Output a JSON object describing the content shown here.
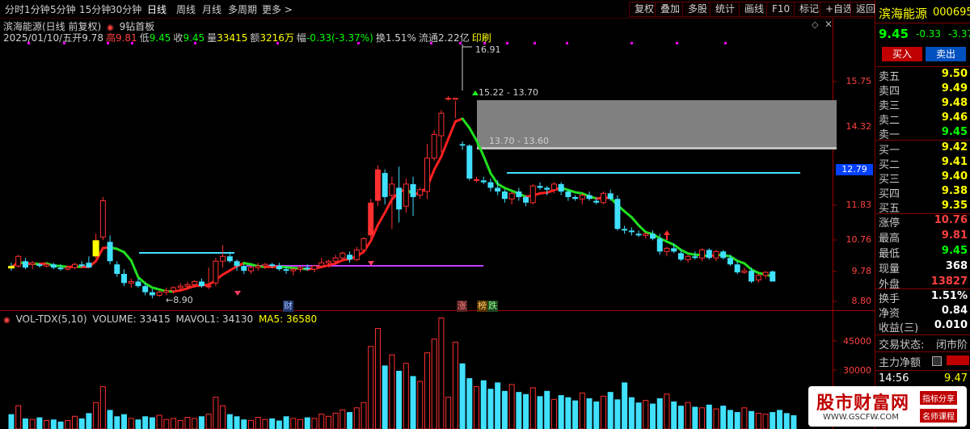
{
  "tabs": [
    "分时",
    "1分钟",
    "5分钟",
    "15分钟",
    "30分钟",
    "日线",
    "周线",
    "月线",
    "多周期",
    "更多 >"
  ],
  "active_tab": "日线",
  "right_tabs": [
    "复权",
    "叠加",
    "多股",
    "统计",
    "画线",
    "F10",
    "标记",
    "+自选",
    "返回"
  ],
  "info": {
    "name": "滨海能源(日线 前复权)",
    "indicator": "9钻首板",
    "date": "2025/01/10/五",
    "open_label": "开",
    "open": "9.78",
    "high_label": "高",
    "high": "9.81",
    "low_label": "低",
    "low": "9.45",
    "close_label": "收",
    "close": "9.45",
    "vol_label": "量",
    "vol": "33415",
    "amt_label": "额",
    "amt": "3216万",
    "amp_label": "幅",
    "amp": "-0.33(-3.37%)",
    "turn_label": "换",
    "turn": "1.51%",
    "float_label": "流通",
    "float": "2.22亿",
    "print": "印刷"
  },
  "price_axis": [
    "15.75",
    "14.32",
    "12.79",
    "11.83",
    "10.76",
    "9.78",
    "8.80"
  ],
  "current_price_tag": "12.79",
  "annotations": {
    "high_label": "16.91",
    "zone_top_label": "15.22 - 13.70",
    "zone_bottom_label": "13.70 - 13.60",
    "low_label": "8.90",
    "cai": "财",
    "zhang": "涨",
    "die": "跌",
    "bang": "榜"
  },
  "volume_indicator": {
    "name": "VOL-TDX(5,10)",
    "volume": "VOLUME: 33415",
    "mavol1": "MAVOL1: 34130",
    "ma5": "MA5: 36580",
    "axis": [
      "45000",
      "30000"
    ]
  },
  "panel": {
    "stock_name": "滨海能源",
    "code": "000695",
    "price": "9.45",
    "change": "-0.33",
    "change_pct": "-3.37",
    "buy_button": "买入",
    "sell_button": "卖出",
    "asks": [
      {
        "label": "卖五",
        "value": "9.50"
      },
      {
        "label": "卖四",
        "value": "9.49"
      },
      {
        "label": "卖三",
        "value": "9.48"
      },
      {
        "label": "卖二",
        "value": "9.46"
      },
      {
        "label": "卖一",
        "value": "9.45"
      }
    ],
    "bids": [
      {
        "label": "买一",
        "value": "9.42"
      },
      {
        "label": "买二",
        "value": "9.41"
      },
      {
        "label": "买三",
        "value": "9.40"
      },
      {
        "label": "买四",
        "value": "9.38"
      },
      {
        "label": "买五",
        "value": "9.35"
      }
    ],
    "stats": [
      {
        "label": "涨停",
        "value": "10.76",
        "color": "#ff4040"
      },
      {
        "label": "最高",
        "value": "9.81",
        "color": "#ff4040"
      },
      {
        "label": "最低",
        "value": "9.45",
        "color": "#00ff00"
      },
      {
        "label": "现量",
        "value": "368",
        "color": "#ffffff"
      },
      {
        "label": "外盘",
        "value": "13827",
        "color": "#ff4040"
      }
    ],
    "stats2": [
      {
        "label": "换手",
        "value": "1.51%",
        "color": "#ffffff"
      },
      {
        "label": "净资",
        "value": "0.84",
        "color": "#ffffff"
      },
      {
        "label": "收益(三)",
        "value": "0.010",
        "color": "#ffffff"
      }
    ],
    "trade_status_label": "交易状态:",
    "trade_status": "闭市阶",
    "net_flow_label": "主力净额",
    "time": "14:56",
    "time_price": "9.47"
  },
  "watermark": {
    "text": "股市财富网",
    "url": "WWW.GSCFW.COM",
    "tag1": "指标分享",
    "tag2": "名师课程"
  },
  "chart_data": {
    "type": "candlestick",
    "candles": [
      [
        9.95,
        10.05,
        9.8,
        9.9
      ],
      [
        9.95,
        10.3,
        9.9,
        10.25
      ],
      [
        10.1,
        10.2,
        9.85,
        9.9
      ],
      [
        10.0,
        10.1,
        9.85,
        10.05
      ],
      [
        10.0,
        10.05,
        9.9,
        9.95
      ],
      [
        9.95,
        10.05,
        9.9,
        10.0
      ],
      [
        10.0,
        10.05,
        9.85,
        9.9
      ],
      [
        9.9,
        10.0,
        9.8,
        9.85
      ],
      [
        9.85,
        9.95,
        9.8,
        9.9
      ],
      [
        9.9,
        10.05,
        9.85,
        10.0
      ],
      [
        10.0,
        10.1,
        9.9,
        9.95
      ],
      [
        10.05,
        10.25,
        9.9,
        9.9
      ],
      [
        10.25,
        10.95,
        10.2,
        10.75
      ],
      [
        10.85,
        12.05,
        10.75,
        11.95
      ],
      [
        10.7,
        10.9,
        10.0,
        10.1
      ],
      [
        10.0,
        10.1,
        9.6,
        9.7
      ],
      [
        9.7,
        9.85,
        9.3,
        9.4
      ],
      [
        9.4,
        9.55,
        9.25,
        9.45
      ],
      [
        9.45,
        9.55,
        9.25,
        9.3
      ],
      [
        9.3,
        9.4,
        9.0,
        9.1
      ],
      [
        9.1,
        9.2,
        8.9,
        9.0
      ],
      [
        9.0,
        9.15,
        8.95,
        9.1
      ],
      [
        9.1,
        9.25,
        9.0,
        9.15
      ],
      [
        9.15,
        9.3,
        9.05,
        9.25
      ],
      [
        9.25,
        9.4,
        9.15,
        9.3
      ],
      [
        9.3,
        9.45,
        9.2,
        9.35
      ],
      [
        9.35,
        9.5,
        9.25,
        9.45
      ],
      [
        9.45,
        9.55,
        9.25,
        9.3
      ],
      [
        9.3,
        9.9,
        9.2,
        9.3
      ],
      [
        9.4,
        10.2,
        9.3,
        10.1
      ],
      [
        10.1,
        10.6,
        9.9,
        10.25
      ],
      [
        10.25,
        10.4,
        10.05,
        10.1
      ],
      [
        10.1,
        10.15,
        9.8,
        9.95
      ],
      [
        9.95,
        10.0,
        9.7,
        9.8
      ],
      [
        9.8,
        9.95,
        9.7,
        9.9
      ],
      [
        9.9,
        10.05,
        9.8,
        9.95
      ],
      [
        9.95,
        10.05,
        9.85,
        10.0
      ],
      [
        10.0,
        10.05,
        9.9,
        9.95
      ],
      [
        9.95,
        10.05,
        9.8,
        9.85
      ],
      [
        9.85,
        9.95,
        9.7,
        9.8
      ],
      [
        9.8,
        9.9,
        9.65,
        9.85
      ],
      [
        9.85,
        9.95,
        9.75,
        9.9
      ],
      [
        9.9,
        10.0,
        9.8,
        9.85
      ],
      [
        9.85,
        9.95,
        9.75,
        9.95
      ],
      [
        9.95,
        10.2,
        9.9,
        10.05
      ],
      [
        10.05,
        10.15,
        9.9,
        10.1
      ],
      [
        10.1,
        10.3,
        10.0,
        10.2
      ],
      [
        10.2,
        10.4,
        10.1,
        10.35
      ],
      [
        10.3,
        10.4,
        10.05,
        10.15
      ],
      [
        10.15,
        10.55,
        10.1,
        10.45
      ],
      [
        10.45,
        10.85,
        10.45,
        10.8
      ],
      [
        10.9,
        12.0,
        10.8,
        11.9
      ],
      [
        11.95,
        12.95,
        11.8,
        12.8
      ],
      [
        12.7,
        12.8,
        11.85,
        12.05
      ],
      [
        12.1,
        12.6,
        11.1,
        12.4
      ],
      [
        12.3,
        12.9,
        11.3,
        11.7
      ],
      [
        11.8,
        12.55,
        11.6,
        12.4
      ],
      [
        12.4,
        12.6,
        11.5,
        12.05
      ],
      [
        12.1,
        12.3,
        12.0,
        12.25
      ],
      [
        12.2,
        13.7,
        12.0,
        13.2
      ],
      [
        13.2,
        14.2,
        13.1,
        14.05
      ],
      [
        14.0,
        14.85,
        13.4,
        14.75
      ],
      [
        15.2,
        15.3,
        15.15,
        15.22
      ],
      [
        15.22,
        16.91,
        15.15,
        15.22
      ],
      [
        13.7,
        13.8,
        13.5,
        13.65
      ],
      [
        13.65,
        13.7,
        12.5,
        12.55
      ],
      [
        12.5,
        12.6,
        12.45,
        12.52
      ],
      [
        12.5,
        12.6,
        12.4,
        12.45
      ],
      [
        12.45,
        12.55,
        12.2,
        12.3
      ],
      [
        12.3,
        12.5,
        12.1,
        12.2
      ],
      [
        12.2,
        12.25,
        11.9,
        12.0
      ],
      [
        12.0,
        12.2,
        11.85,
        12.15
      ],
      [
        12.2,
        12.3,
        11.95,
        12.05
      ],
      [
        12.05,
        12.1,
        11.8,
        11.9
      ],
      [
        11.9,
        12.4,
        11.85,
        12.35
      ],
      [
        12.35,
        12.45,
        12.25,
        12.3
      ],
      [
        12.3,
        12.35,
        12.1,
        12.25
      ],
      [
        12.25,
        12.45,
        12.15,
        12.4
      ],
      [
        12.4,
        12.45,
        12.1,
        12.2
      ],
      [
        12.2,
        12.25,
        11.95,
        12.05
      ],
      [
        12.05,
        12.1,
        11.95,
        12.0
      ],
      [
        12.0,
        12.15,
        11.85,
        12.1
      ],
      [
        12.1,
        12.2,
        11.95,
        12.0
      ],
      [
        11.95,
        12.05,
        11.85,
        11.9
      ],
      [
        11.9,
        12.2,
        11.85,
        12.15
      ],
      [
        12.15,
        12.25,
        11.95,
        12.0
      ],
      [
        12.0,
        12.1,
        11.05,
        11.1
      ],
      [
        11.1,
        11.2,
        10.95,
        11.05
      ],
      [
        11.05,
        11.15,
        10.9,
        11.0
      ],
      [
        10.95,
        11.05,
        10.85,
        10.9
      ],
      [
        10.9,
        11.0,
        10.8,
        10.95
      ],
      [
        10.95,
        11.05,
        10.75,
        10.8
      ],
      [
        10.8,
        10.95,
        10.3,
        10.4
      ],
      [
        10.4,
        10.55,
        10.25,
        10.5
      ],
      [
        10.5,
        10.65,
        10.35,
        10.4
      ],
      [
        10.35,
        10.45,
        10.1,
        10.15
      ],
      [
        10.15,
        10.3,
        10.05,
        10.25
      ],
      [
        10.25,
        10.4,
        10.15,
        10.2
      ],
      [
        10.2,
        10.5,
        10.1,
        10.45
      ],
      [
        10.45,
        10.5,
        10.15,
        10.2
      ],
      [
        10.2,
        10.45,
        10.1,
        10.4
      ],
      [
        10.4,
        10.45,
        10.15,
        10.2
      ],
      [
        10.2,
        10.3,
        9.95,
        10.0
      ],
      [
        10.0,
        10.1,
        9.7,
        9.75
      ],
      [
        9.75,
        9.9,
        9.7,
        9.8
      ],
      [
        9.8,
        9.9,
        9.4,
        9.45
      ],
      [
        9.5,
        9.7,
        9.4,
        9.65
      ],
      [
        9.65,
        9.8,
        9.55,
        9.75
      ],
      [
        9.78,
        9.81,
        9.45,
        9.45
      ]
    ],
    "volume": [
      14,
      22,
      10,
      9,
      11,
      8,
      9,
      7,
      8,
      12,
      10,
      15,
      25,
      40,
      18,
      12,
      14,
      10,
      9,
      12,
      11,
      13,
      9,
      10,
      8,
      11,
      10,
      12,
      14,
      30,
      22,
      14,
      12,
      9,
      8,
      11,
      9,
      10,
      8,
      12,
      10,
      9,
      11,
      10,
      14,
      12,
      15,
      18,
      16,
      20,
      25,
      78,
      95,
      60,
      70,
      55,
      62,
      50,
      45,
      72,
      85,
      105,
      30,
      82,
      62,
      48,
      40,
      46,
      38,
      44,
      36,
      42,
      35,
      33,
      39,
      31,
      36,
      28,
      32,
      30,
      27,
      34,
      29,
      26,
      31,
      35,
      28,
      44,
      30,
      25,
      27,
      24,
      29,
      33,
      26,
      22,
      25,
      21,
      20,
      23,
      19,
      22,
      18,
      16,
      20,
      17,
      15,
      14,
      16,
      18,
      15,
      13
    ],
    "ylim": [
      8.6,
      17.0
    ],
    "vol_ylim": [
      0,
      60000
    ]
  }
}
